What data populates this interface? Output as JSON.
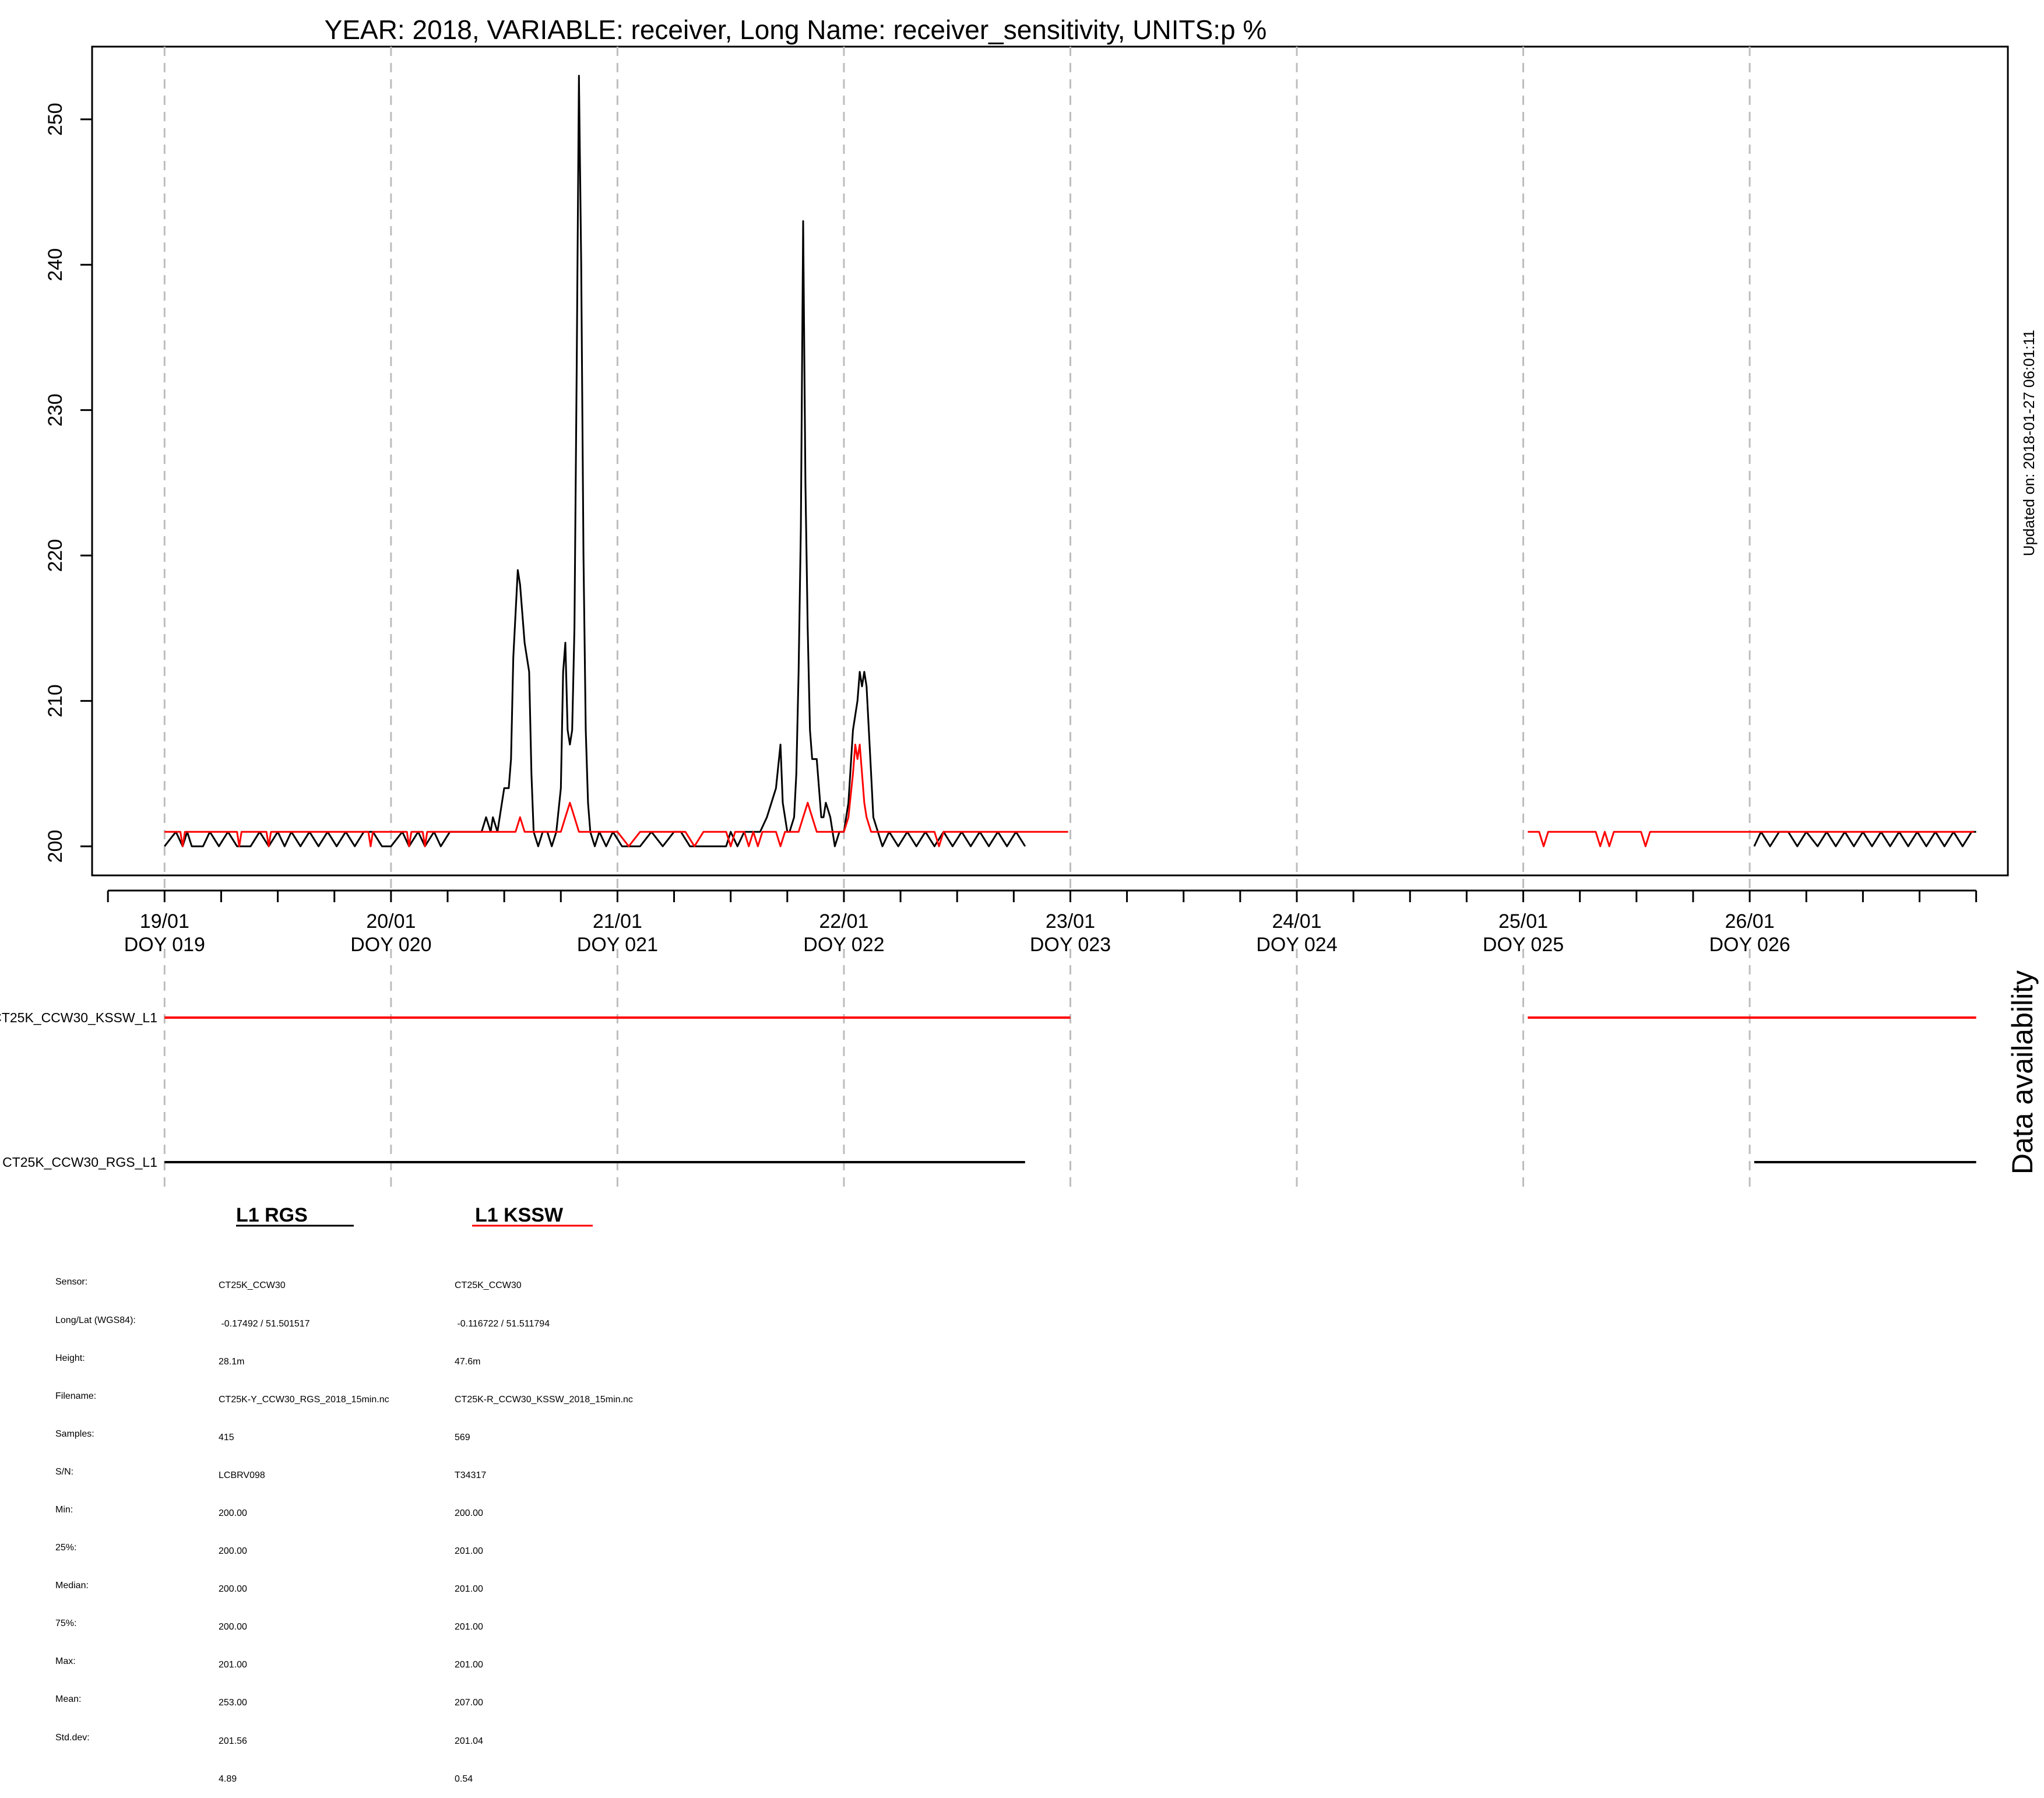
{
  "chart_data": {
    "type": "line",
    "title": "YEAR: 2018, VARIABLE: receiver, Long Name: receiver_sensitivity, UNITS:p %",
    "ylabel": "",
    "xlabel": "",
    "ylim": [
      198,
      255
    ],
    "xlim": [
      -0.32,
      8.14
    ],
    "yticks": [
      200,
      210,
      220,
      230,
      240,
      250
    ],
    "xticks": [
      {
        "pos": 0,
        "date": "19/01",
        "doy": "DOY 019"
      },
      {
        "pos": 1,
        "date": "20/01",
        "doy": "DOY 020"
      },
      {
        "pos": 2,
        "date": "21/01",
        "doy": "DOY 021"
      },
      {
        "pos": 3,
        "date": "22/01",
        "doy": "DOY 022"
      },
      {
        "pos": 4,
        "date": "23/01",
        "doy": "DOY 023"
      },
      {
        "pos": 5,
        "date": "24/01",
        "doy": "DOY 024"
      },
      {
        "pos": 6,
        "date": "25/01",
        "doy": "DOY 025"
      },
      {
        "pos": 7,
        "date": "26/01",
        "doy": "DOY 026"
      }
    ],
    "x_unit": "days from 19/01 00:00",
    "grid": "vertical dashed at day boundaries",
    "series": [
      {
        "name": "CT25K_CCW30_RGS_L1",
        "color": "#000000",
        "segments": [
          [
            [
              0,
              200
            ],
            [
              0.05,
              201
            ],
            [
              0.08,
              200
            ],
            [
              0.1,
              201
            ],
            [
              0.12,
              200
            ],
            [
              0.17,
              200
            ],
            [
              0.2,
              201
            ],
            [
              0.24,
              200
            ],
            [
              0.28,
              201
            ],
            [
              0.32,
              200
            ],
            [
              0.38,
              200
            ],
            [
              0.42,
              201
            ],
            [
              0.46,
              200
            ],
            [
              0.5,
              201
            ],
            [
              0.53,
              200
            ],
            [
              0.56,
              201
            ],
            [
              0.6,
              200
            ],
            [
              0.64,
              201
            ],
            [
              0.68,
              200
            ],
            [
              0.72,
              201
            ],
            [
              0.76,
              200
            ],
            [
              0.8,
              201
            ],
            [
              0.84,
              200
            ],
            [
              0.88,
              201
            ],
            [
              0.92,
              201
            ],
            [
              0.96,
              200
            ],
            [
              1.0,
              200
            ],
            [
              1.05,
              201
            ],
            [
              1.08,
              200
            ],
            [
              1.12,
              201
            ],
            [
              1.15,
              200
            ],
            [
              1.19,
              201
            ],
            [
              1.22,
              200
            ],
            [
              1.26,
              201
            ],
            [
              1.3,
              201
            ],
            [
              1.34,
              201
            ],
            [
              1.38,
              201
            ],
            [
              1.4,
              201
            ],
            [
              1.42,
              202
            ],
            [
              1.44,
              201
            ],
            [
              1.45,
              202
            ],
            [
              1.47,
              201
            ],
            [
              1.49,
              203
            ],
            [
              1.5,
              204
            ],
            [
              1.52,
              204
            ],
            [
              1.53,
              206
            ],
            [
              1.54,
              213
            ],
            [
              1.56,
              219
            ],
            [
              1.57,
              218
            ],
            [
              1.58,
              216
            ],
            [
              1.59,
              214
            ],
            [
              1.6,
              213
            ],
            [
              1.61,
              212
            ],
            [
              1.62,
              205
            ],
            [
              1.63,
              201
            ],
            [
              1.65,
              200
            ],
            [
              1.67,
              201
            ],
            [
              1.69,
              201
            ],
            [
              1.71,
              200
            ],
            [
              1.73,
              201
            ],
            [
              1.75,
              204
            ],
            [
              1.76,
              212
            ],
            [
              1.77,
              214
            ],
            [
              1.78,
              208
            ],
            [
              1.79,
              207
            ],
            [
              1.8,
              208
            ],
            [
              1.81,
              215
            ],
            [
              1.82,
              233
            ],
            [
              1.83,
              253
            ],
            [
              1.84,
              240
            ],
            [
              1.85,
              220
            ],
            [
              1.86,
              208
            ],
            [
              1.87,
              203
            ],
            [
              1.88,
              201
            ],
            [
              1.9,
              200
            ],
            [
              1.92,
              201
            ],
            [
              1.95,
              200
            ],
            [
              1.98,
              201
            ],
            [
              2.02,
              200
            ],
            [
              2.1,
              200
            ],
            [
              2.15,
              201
            ],
            [
              2.2,
              200
            ],
            [
              2.25,
              201
            ],
            [
              2.28,
              201
            ],
            [
              2.32,
              200
            ],
            [
              2.4,
              200
            ],
            [
              2.48,
              200
            ],
            [
              2.5,
              201
            ],
            [
              2.53,
              200
            ],
            [
              2.56,
              201
            ],
            [
              2.6,
              201
            ],
            [
              2.63,
              201
            ],
            [
              2.66,
              202
            ],
            [
              2.68,
              203
            ],
            [
              2.7,
              204
            ],
            [
              2.72,
              207
            ],
            [
              2.73,
              203
            ],
            [
              2.75,
              201
            ],
            [
              2.76,
              201
            ],
            [
              2.78,
              202
            ],
            [
              2.79,
              205
            ],
            [
              2.8,
              212
            ],
            [
              2.81,
              222
            ],
            [
              2.82,
              243
            ],
            [
              2.83,
              225
            ],
            [
              2.84,
              215
            ],
            [
              2.85,
              208
            ],
            [
              2.86,
              206
            ],
            [
              2.88,
              206
            ],
            [
              2.89,
              204
            ],
            [
              2.9,
              202
            ],
            [
              2.91,
              202
            ],
            [
              2.92,
              203
            ],
            [
              2.94,
              202
            ],
            [
              2.95,
              201
            ],
            [
              2.96,
              200
            ],
            [
              2.98,
              201
            ],
            [
              3.0,
              201
            ],
            [
              3.02,
              203
            ],
            [
              3.04,
              208
            ],
            [
              3.06,
              210
            ],
            [
              3.07,
              212
            ],
            [
              3.08,
              211
            ],
            [
              3.09,
              212
            ],
            [
              3.1,
              211
            ],
            [
              3.11,
              208
            ],
            [
              3.12,
              205
            ],
            [
              3.13,
              202
            ],
            [
              3.15,
              201
            ],
            [
              3.17,
              200
            ],
            [
              3.2,
              201
            ],
            [
              3.24,
              200
            ],
            [
              3.28,
              201
            ],
            [
              3.32,
              200
            ],
            [
              3.36,
              201
            ],
            [
              3.4,
              200
            ],
            [
              3.44,
              201
            ],
            [
              3.48,
              200
            ],
            [
              3.52,
              201
            ],
            [
              3.56,
              200
            ],
            [
              3.6,
              201
            ],
            [
              3.64,
              200
            ],
            [
              3.68,
              201
            ],
            [
              3.72,
              200
            ],
            [
              3.76,
              201
            ],
            [
              3.8,
              200
            ]
          ],
          [
            [
              7.02,
              200
            ],
            [
              7.05,
              201
            ],
            [
              7.09,
              200
            ],
            [
              7.13,
              201
            ],
            [
              7.17,
              201
            ],
            [
              7.21,
              200
            ],
            [
              7.25,
              201
            ],
            [
              7.3,
              200
            ],
            [
              7.34,
              201
            ],
            [
              7.38,
              200
            ],
            [
              7.42,
              201
            ],
            [
              7.46,
              200
            ],
            [
              7.5,
              201
            ],
            [
              7.54,
              200
            ],
            [
              7.58,
              201
            ],
            [
              7.62,
              200
            ],
            [
              7.66,
              201
            ],
            [
              7.7,
              200
            ],
            [
              7.74,
              201
            ],
            [
              7.78,
              200
            ],
            [
              7.82,
              201
            ],
            [
              7.86,
              200
            ],
            [
              7.9,
              201
            ],
            [
              7.94,
              200
            ],
            [
              7.98,
              201
            ],
            [
              8.0,
              201
            ]
          ]
        ]
      },
      {
        "name": "CT25K_CCW30_KSSW_L1",
        "color": "#ff0000",
        "segments": [
          [
            [
              0,
              201
            ],
            [
              0.07,
              201
            ],
            [
              0.08,
              200
            ],
            [
              0.09,
              201
            ],
            [
              0.32,
              201
            ],
            [
              0.33,
              200
            ],
            [
              0.34,
              201
            ],
            [
              0.45,
              201
            ],
            [
              0.46,
              200
            ],
            [
              0.47,
              201
            ],
            [
              0.9,
              201
            ],
            [
              0.91,
              200
            ],
            [
              0.92,
              201
            ],
            [
              1.07,
              201
            ],
            [
              1.08,
              200
            ],
            [
              1.09,
              201
            ],
            [
              1.14,
              201
            ],
            [
              1.15,
              200
            ],
            [
              1.16,
              201
            ],
            [
              1.55,
              201
            ],
            [
              1.57,
              202
            ],
            [
              1.59,
              201
            ],
            [
              1.75,
              201
            ],
            [
              1.77,
              202
            ],
            [
              1.79,
              203
            ],
            [
              1.81,
              202
            ],
            [
              1.83,
              201
            ],
            [
              2.0,
              201
            ],
            [
              2.05,
              200
            ],
            [
              2.1,
              201
            ],
            [
              2.3,
              201
            ],
            [
              2.34,
              200
            ],
            [
              2.38,
              201
            ],
            [
              2.48,
              201
            ],
            [
              2.5,
              200
            ],
            [
              2.52,
              201
            ],
            [
              2.56,
              201
            ],
            [
              2.58,
              200
            ],
            [
              2.6,
              201
            ],
            [
              2.62,
              200
            ],
            [
              2.64,
              201
            ],
            [
              2.7,
              201
            ],
            [
              2.72,
              200
            ],
            [
              2.74,
              201
            ],
            [
              2.8,
              201
            ],
            [
              2.82,
              202
            ],
            [
              2.84,
              203
            ],
            [
              2.86,
              202
            ],
            [
              2.88,
              201
            ],
            [
              3.0,
              201
            ],
            [
              3.02,
              202
            ],
            [
              3.04,
              205
            ],
            [
              3.05,
              207
            ],
            [
              3.06,
              206
            ],
            [
              3.07,
              207
            ],
            [
              3.08,
              205
            ],
            [
              3.09,
              203
            ],
            [
              3.1,
              202
            ],
            [
              3.12,
              201
            ],
            [
              3.4,
              201
            ],
            [
              3.42,
              200
            ],
            [
              3.44,
              201
            ],
            [
              3.99,
              201
            ]
          ],
          [
            [
              6.02,
              201
            ],
            [
              6.07,
              201
            ],
            [
              6.09,
              200
            ],
            [
              6.11,
              201
            ],
            [
              6.32,
              201
            ],
            [
              6.34,
              200
            ],
            [
              6.36,
              201
            ],
            [
              6.38,
              200
            ],
            [
              6.4,
              201
            ],
            [
              6.52,
              201
            ],
            [
              6.54,
              200
            ],
            [
              6.56,
              201
            ],
            [
              7.99,
              201
            ]
          ]
        ]
      }
    ]
  },
  "availability": {
    "label": "Data availability",
    "rows": [
      {
        "name": "CT25K_CCW30_KSSW_L1",
        "color": "#ff0000",
        "ranges": [
          [
            0,
            4.0
          ],
          [
            6.02,
            8.0
          ]
        ]
      },
      {
        "name": "CT25K_CCW30_RGS_L1",
        "color": "#000000",
        "ranges": [
          [
            0,
            3.8
          ],
          [
            7.02,
            8.0
          ]
        ]
      }
    ]
  },
  "updated_note": "Updated on: 2018-01-27 06:01:11",
  "legend": [
    {
      "label": "L1 RGS",
      "color": "#000000"
    },
    {
      "label": "L1 KSSW",
      "color": "#ff0000"
    }
  ],
  "stats": {
    "labels": [
      "Sensor:",
      "Long/Lat (WGS84):",
      "Height:",
      "Filename:",
      "Samples:",
      "S/N:",
      "Min:",
      "25%:",
      "Median:",
      "75%:",
      "Max:",
      "Mean:",
      "Std.dev:"
    ],
    "rgs": [
      "CT25K_CCW30",
      " -0.17492 / 51.501517",
      "28.1m",
      "CT25K-Y_CCW30_RGS_2018_15min.nc",
      "415",
      "LCBRV098",
      "200.00",
      "200.00",
      "200.00",
      "200.00",
      "201.00",
      "253.00",
      "201.56",
      "4.89"
    ],
    "kssw": [
      "CT25K_CCW30",
      " -0.116722 / 51.511794",
      "47.6m",
      "CT25K-R_CCW30_KSSW_2018_15min.nc",
      "569",
      "T34317",
      "200.00",
      "201.00",
      "201.00",
      "201.00",
      "201.00",
      "207.00",
      "201.04",
      "0.54"
    ]
  }
}
